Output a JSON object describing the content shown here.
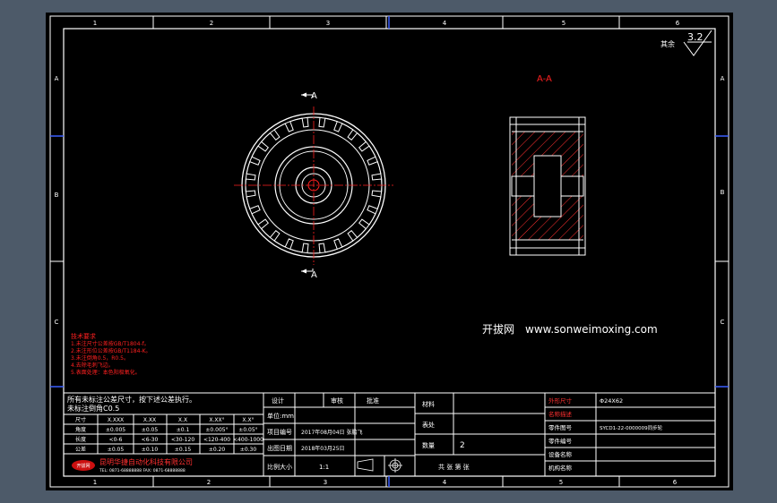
{
  "frame": {
    "zones_top": [
      "1",
      "2",
      "3",
      "4",
      "5",
      "6"
    ],
    "zones_bottom": [
      "1",
      "2",
      "3",
      "4",
      "5",
      "6"
    ],
    "zones_left": [
      "A",
      "B",
      "C"
    ],
    "zones_right": [
      "A",
      "B",
      "C"
    ]
  },
  "drawing": {
    "roughness_label": "其余",
    "roughness_value": "3.2",
    "section_label": "A-A",
    "section_marker_top": "A",
    "section_marker_bottom": "A"
  },
  "watermark": {
    "brand": "开拔网",
    "url": "www.sonweimoxing.com"
  },
  "technical_requirements": {
    "title": "技术要求",
    "items": [
      "1.未注尺寸公差按GB/T1804-f。",
      "2.未注形位公差按GB/T1184-K。",
      "3.未注倒角0.5，R0.5。",
      "4.去除毛刺飞边。",
      "5.表面处理：本色阳极氧化。"
    ]
  },
  "tolerance_table": {
    "note_line1": "所有未标注公差尺寸，按下述公差执行。",
    "note_line2": "未标注倒角C0.5",
    "header": [
      "尺寸",
      "X.XXX",
      "X.XX",
      "X.X",
      "X.XX°",
      "X.X°"
    ],
    "rows": [
      [
        "角度",
        "±0.005",
        "±0.05",
        "±0.1",
        "±0.005°",
        "±0.05°"
      ],
      [
        "长度",
        "<0-6",
        "<6-30",
        "<30-120",
        "<120-400",
        "<400-1000"
      ],
      [
        "公差",
        "±0.05",
        "±0.10",
        "±0.15",
        "±0.20",
        "±0.30"
      ]
    ]
  },
  "company": {
    "logo_text": "开拔网",
    "name": "昆明华捷自动化科技有限公司",
    "sub": "TEL: 0871-68888888  FAX: 0871-68888888"
  },
  "title_block": {
    "design_label": "设计",
    "review_label": "审核",
    "approve_label": "批准",
    "unit_label": "单位:mm",
    "project_label": "项目编号",
    "project_value": "2017年08月04日  张鹏飞",
    "date_label": "出图日期",
    "date_value": "2018年03月25日",
    "scale_label": "比例大小",
    "scale_value": "1:1",
    "material_label": "材料",
    "process_label": "表处",
    "qty_label": "数量",
    "qty_value": "2",
    "sheet_label": "共  张  第  张",
    "size_label": "外形尺寸",
    "size_value": "Φ24X62",
    "name_label": "名称描述",
    "drawing_no_label": "零件图号",
    "drawing_no_value": "SYCD1-22-0000009同步轮",
    "part_no_label": "零件编号",
    "machine_label": "设备名称",
    "customer_label": "机构名称"
  }
}
